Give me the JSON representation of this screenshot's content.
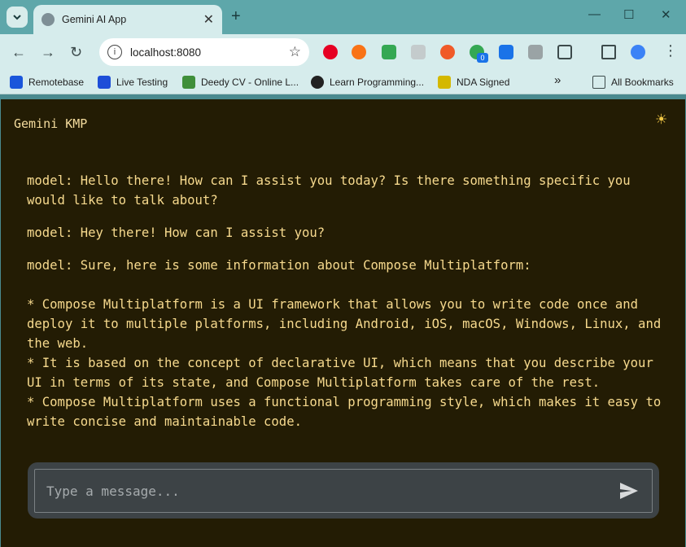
{
  "browser": {
    "tab_title": "Gemini AI App",
    "tab_close": "✕",
    "new_tab": "+",
    "window_controls": {
      "minimize": "—",
      "maximize": "☐",
      "close": "✕"
    },
    "url": "localhost:8080",
    "bookmarks": [
      {
        "label": "Remotebase",
        "color": "#1a56db"
      },
      {
        "label": "Live Testing",
        "color": "#1d4ed8"
      },
      {
        "label": "Deedy CV - Online L...",
        "color": "#3f8f3a"
      },
      {
        "label": "Learn Programming...",
        "color": "#222222"
      },
      {
        "label": "NDA Signed",
        "color": "#d4b800"
      }
    ],
    "bookmarks_overflow": "»",
    "all_bookmarks": "All Bookmarks",
    "extensions": [
      {
        "name": "pinterest-icon",
        "color": "#e60023"
      },
      {
        "name": "sync-icon",
        "color": "#f97316"
      },
      {
        "name": "shield-check-icon",
        "color": "#34a853"
      },
      {
        "name": "u-icon",
        "color": "#9aa3a5"
      },
      {
        "name": "tampermonkey-icon",
        "color": "#f05a28"
      },
      {
        "name": "chrome-ext-icon",
        "color": "#34a853"
      },
      {
        "name": "vpn-shield-icon",
        "color": "#1a73e8"
      },
      {
        "name": "camera-icon",
        "color": "#9aa3a5"
      }
    ],
    "extension_badge": "0"
  },
  "app": {
    "title": "Gemini KMP",
    "theme_icon": "☀",
    "messages": [
      "model: Hello there! How can I assist you today? Is there something specific you would like to talk about?",
      "model: Hey there! How can I assist you?",
      "model: Sure, here is some information about Compose Multiplatform:\n\n* Compose Multiplatform is a UI framework that allows you to write code once and deploy it to multiple platforms, including Android, iOS, macOS, Windows, Linux, and the web.\n* It is based on the concept of declarative UI, which means that you describe your UI in terms of its state, and Compose Multiplatform takes care of the rest.\n* Compose Multiplatform uses a functional programming style, which makes it easy to write concise and maintainable code."
    ],
    "input_placeholder": "Type a message..."
  },
  "colors": {
    "app_bg": "#231c04",
    "text": "#f7da8e",
    "accent": "#f2c845",
    "composer_bg": "#3d4346"
  }
}
